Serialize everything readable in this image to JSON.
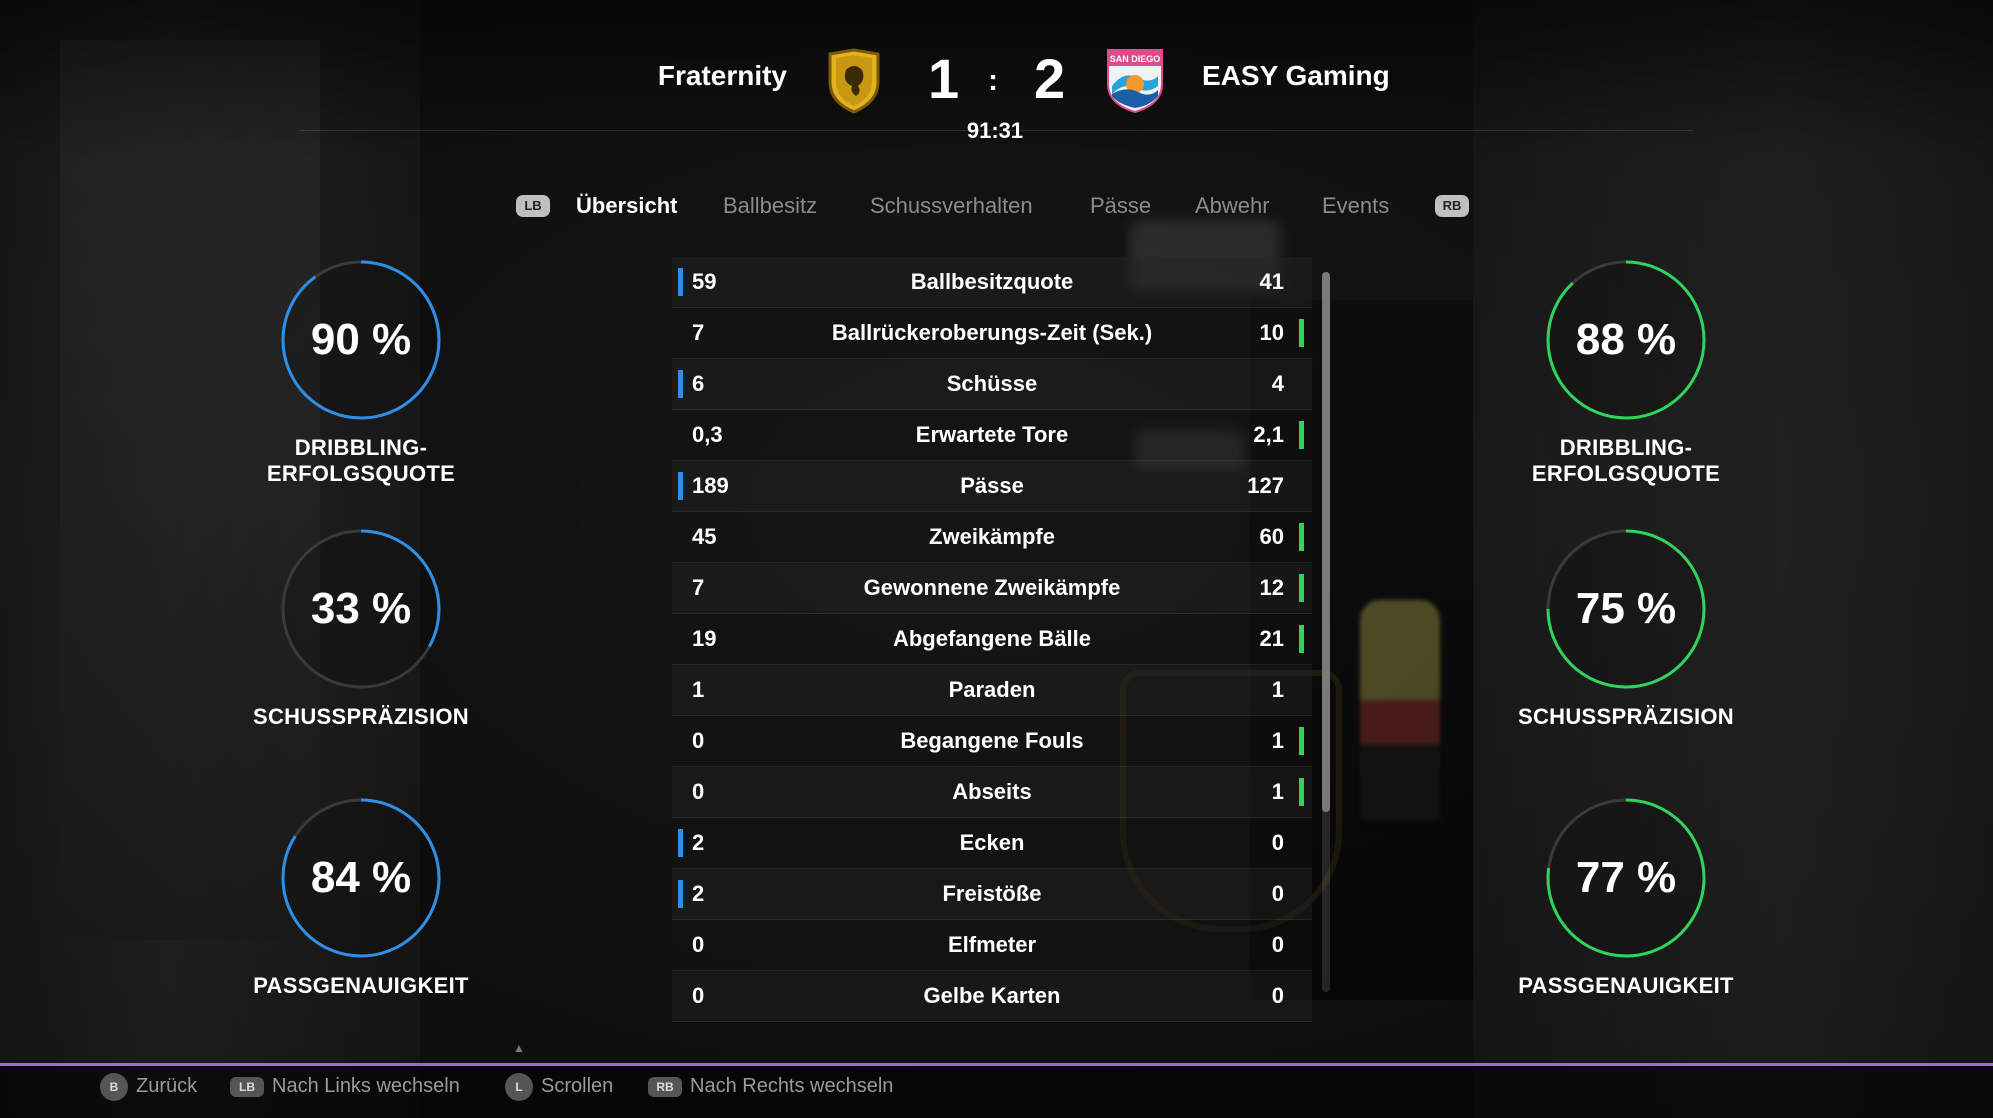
{
  "colors": {
    "home_accent": "#2f8fe8",
    "away_accent": "#2fd45a",
    "footer_line": "#9a6bd8"
  },
  "match": {
    "home_team": "Fraternity",
    "away_team": "EASY Gaming",
    "home_score": "1",
    "away_score": "2",
    "separator": ":",
    "clock": "91:31",
    "home_crest_icon": "lion-shield-crest-icon",
    "away_crest_icon": "san-diego-wave-crest-icon",
    "away_crest_text": "SAN DIEGO"
  },
  "tabs": {
    "left_hint": "LB",
    "right_hint": "RB",
    "items": [
      {
        "label": "Übersicht",
        "active": true
      },
      {
        "label": "Ballbesitz",
        "active": false
      },
      {
        "label": "Schussverhalten",
        "active": false
      },
      {
        "label": "Pässe",
        "active": false
      },
      {
        "label": "Abwehr",
        "active": false
      },
      {
        "label": "Events",
        "active": false
      }
    ]
  },
  "home_stats": [
    {
      "value": "90 %",
      "label": "DRIBBLING-ERFOLGSQUOTE",
      "pct": 0.9
    },
    {
      "value": "33 %",
      "label": "SCHUSSPRÄZISION",
      "pct": 0.33
    },
    {
      "value": "84 %",
      "label": "PASSGENAUIGKEIT",
      "pct": 0.84
    }
  ],
  "away_stats": [
    {
      "value": "88 %",
      "label": "DRIBBLING-ERFOLGSQUOTE",
      "pct": 0.88
    },
    {
      "value": "75 %",
      "label": "SCHUSSPRÄZISION",
      "pct": 0.75
    },
    {
      "value": "77 %",
      "label": "PASSGENAUIGKEIT",
      "pct": 0.77
    }
  ],
  "stats_table": {
    "rows": [
      {
        "home": "59",
        "name": "Ballbesitzquote",
        "away": "41",
        "leader": "home"
      },
      {
        "home": "7",
        "name": "Ballrückeroberungs-Zeit (Sek.)",
        "away": "10",
        "leader": "away"
      },
      {
        "home": "6",
        "name": "Schüsse",
        "away": "4",
        "leader": "home"
      },
      {
        "home": "0,3",
        "name": "Erwartete Tore",
        "away": "2,1",
        "leader": "away"
      },
      {
        "home": "189",
        "name": "Pässe",
        "away": "127",
        "leader": "home"
      },
      {
        "home": "45",
        "name": "Zweikämpfe",
        "away": "60",
        "leader": "away"
      },
      {
        "home": "7",
        "name": "Gewonnene Zweikämpfe",
        "away": "12",
        "leader": "away"
      },
      {
        "home": "19",
        "name": "Abgefangene Bälle",
        "away": "21",
        "leader": "away"
      },
      {
        "home": "1",
        "name": "Paraden",
        "away": "1",
        "leader": "none"
      },
      {
        "home": "0",
        "name": "Begangene Fouls",
        "away": "1",
        "leader": "away"
      },
      {
        "home": "0",
        "name": "Abseits",
        "away": "1",
        "leader": "away"
      },
      {
        "home": "2",
        "name": "Ecken",
        "away": "0",
        "leader": "home"
      },
      {
        "home": "2",
        "name": "Freistöße",
        "away": "0",
        "leader": "home"
      },
      {
        "home": "0",
        "name": "Elfmeter",
        "away": "0",
        "leader": "none"
      },
      {
        "home": "0",
        "name": "Gelbe Karten",
        "away": "0",
        "leader": "none"
      }
    ]
  },
  "footer": {
    "back_key": "B",
    "back_label": "Zurück",
    "left_key": "LB",
    "left_label": "Nach Links wechseln",
    "scroll_key": "L",
    "scroll_label": "Scrollen",
    "right_key": "RB",
    "right_label": "Nach Rechts wechseln"
  }
}
